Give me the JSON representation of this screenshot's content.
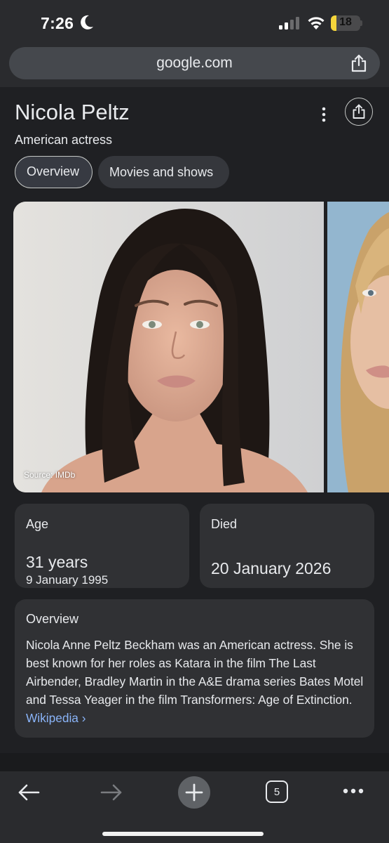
{
  "status_bar": {
    "time": "7:26",
    "battery_label": "18",
    "battery_level_percent": 18,
    "icons": [
      "moon-icon",
      "signal-icon",
      "wifi-icon",
      "battery-icon"
    ]
  },
  "browser": {
    "url": "google.com"
  },
  "entity": {
    "name": "Nicola Peltz",
    "description": "American actress"
  },
  "tabs": [
    {
      "label": "Overview",
      "selected": true
    },
    {
      "label": "Movies and shows",
      "selected": false
    }
  ],
  "image_source": "Source: IMDb",
  "age_card": {
    "label": "Age",
    "value": "31 years",
    "date": "9 January 1995"
  },
  "died_card": {
    "label": "Died",
    "date": "20 January 2026"
  },
  "overview_card": {
    "title": "Overview",
    "text": "Nicola Anne Peltz Beckham was an American actress. She is best known for her roles as Katara in the film The Last Airbender, Bradley Martin in the A&E drama series Bates Motel and Tessa Yeager in the film Transformers: Age of Extinction.",
    "link_label": "Wikipedia ›"
  },
  "toolbar": {
    "tab_count": "5"
  },
  "colors": {
    "background": "#1f2023",
    "card": "#303134",
    "link": "#8ab4f8",
    "battery": "#f5d53b"
  }
}
